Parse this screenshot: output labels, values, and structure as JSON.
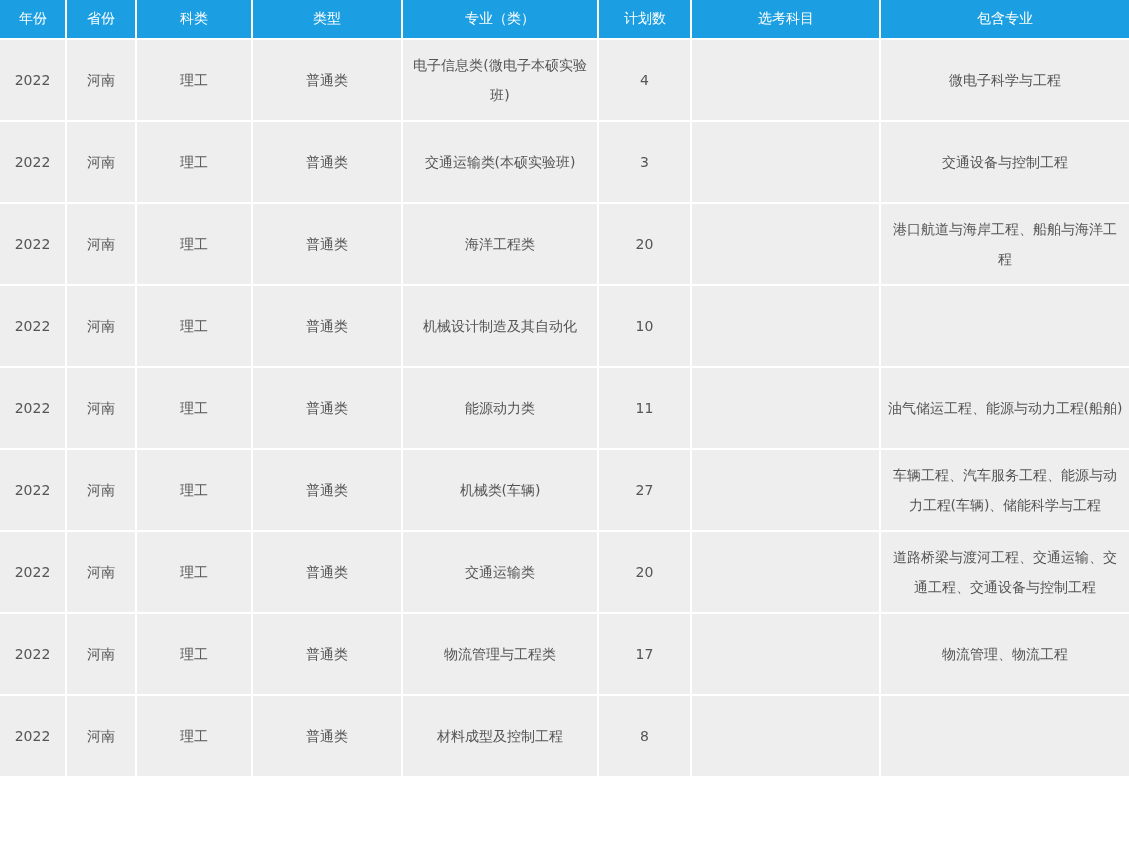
{
  "table": {
    "columns": [
      "年份",
      "省份",
      "科类",
      "类型",
      "专业（类）",
      "计划数",
      "选考科目",
      "包含专业"
    ],
    "rows": [
      {
        "year": "2022",
        "province": "河南",
        "category": "理工",
        "type": "普通类",
        "major": "电子信息类(微电子本硕实验班)",
        "plan": "4",
        "includes": "微电子科学与工程"
      },
      {
        "year": "2022",
        "province": "河南",
        "category": "理工",
        "type": "普通类",
        "major": "交通运输类(本硕实验班)",
        "plan": "3",
        "includes": "交通设备与控制工程"
      },
      {
        "year": "2022",
        "province": "河南",
        "category": "理工",
        "type": "普通类",
        "major": "海洋工程类",
        "plan": "20",
        "includes": "港口航道与海岸工程、船舶与海洋工程"
      },
      {
        "year": "2022",
        "province": "河南",
        "category": "理工",
        "type": "普通类",
        "major": "机械设计制造及其自动化",
        "plan": "10"
      },
      {
        "year": "2022",
        "province": "河南",
        "category": "理工",
        "type": "普通类",
        "major": "能源动力类",
        "plan": "11",
        "includes": "油气储运工程、能源与动力工程(船舶)"
      },
      {
        "year": "2022",
        "province": "河南",
        "category": "理工",
        "type": "普通类",
        "major": "机械类(车辆)",
        "plan": "27",
        "includes": "车辆工程、汽车服务工程、能源与动力工程(车辆)、储能科学与工程"
      },
      {
        "year": "2022",
        "province": "河南",
        "category": "理工",
        "type": "普通类",
        "major": "交通运输类",
        "plan": "20",
        "includes": "道路桥梁与渡河工程、交通运输、交通工程、交通设备与控制工程"
      },
      {
        "year": "2022",
        "province": "河南",
        "category": "理工",
        "type": "普通类",
        "major": "物流管理与工程类",
        "plan": "17",
        "includes": "物流管理、物流工程"
      },
      {
        "year": "2022",
        "province": "河南",
        "category": "理工",
        "type": "普通类",
        "major": "材料成型及控制工程",
        "plan": "8"
      }
    ]
  }
}
